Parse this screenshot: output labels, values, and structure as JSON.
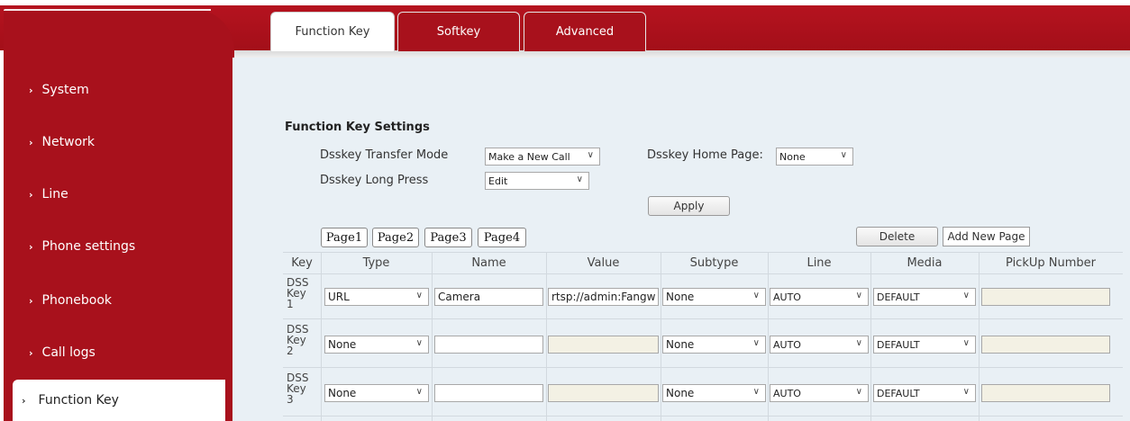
{
  "sidebar": {
    "items": [
      {
        "label": "System"
      },
      {
        "label": "Network"
      },
      {
        "label": "Line"
      },
      {
        "label": "Phone settings"
      },
      {
        "label": "Phonebook"
      },
      {
        "label": "Call logs"
      },
      {
        "label": "Function Key"
      }
    ],
    "active_index": 6
  },
  "tabs": [
    {
      "label": "Function Key",
      "active": true
    },
    {
      "label": "Softkey",
      "active": false
    },
    {
      "label": "Advanced",
      "active": false
    }
  ],
  "settings": {
    "title": "Function Key Settings",
    "transfer_mode_label": "Dsskey Transfer Mode",
    "transfer_mode_value": "Make a New Call",
    "home_page_label": "Dsskey Home Page:",
    "home_page_value": "None",
    "long_press_label": "Dsskey Long Press",
    "long_press_value": "Edit",
    "apply_label": "Apply"
  },
  "pages": [
    "Page1",
    "Page2",
    "Page3",
    "Page4"
  ],
  "actions": {
    "delete_label": "Delete",
    "add_page_label": "Add New Page"
  },
  "table": {
    "headers": [
      "Key",
      "Type",
      "Name",
      "Value",
      "Subtype",
      "Line",
      "Media",
      "PickUp Number"
    ],
    "rows": [
      {
        "key_line1": "DSS",
        "key_line2": "Key",
        "key_line3": "1",
        "type": "URL",
        "name": "Camera",
        "value": "rtsp://admin:Fangw",
        "subtype": "None",
        "line": "AUTO",
        "media": "DEFAULT",
        "pickup": ""
      },
      {
        "key_line1": "DSS",
        "key_line2": "Key",
        "key_line3": "2",
        "type": "None",
        "name": "",
        "value": "",
        "subtype": "None",
        "line": "AUTO",
        "media": "DEFAULT",
        "pickup": ""
      },
      {
        "key_line1": "DSS",
        "key_line2": "Key",
        "key_line3": "3",
        "type": "None",
        "name": "",
        "value": "",
        "subtype": "None",
        "line": "AUTO",
        "media": "DEFAULT",
        "pickup": ""
      }
    ]
  },
  "colors": {
    "brand_red": "#a8111c",
    "content_bg": "#e9f0f5"
  }
}
